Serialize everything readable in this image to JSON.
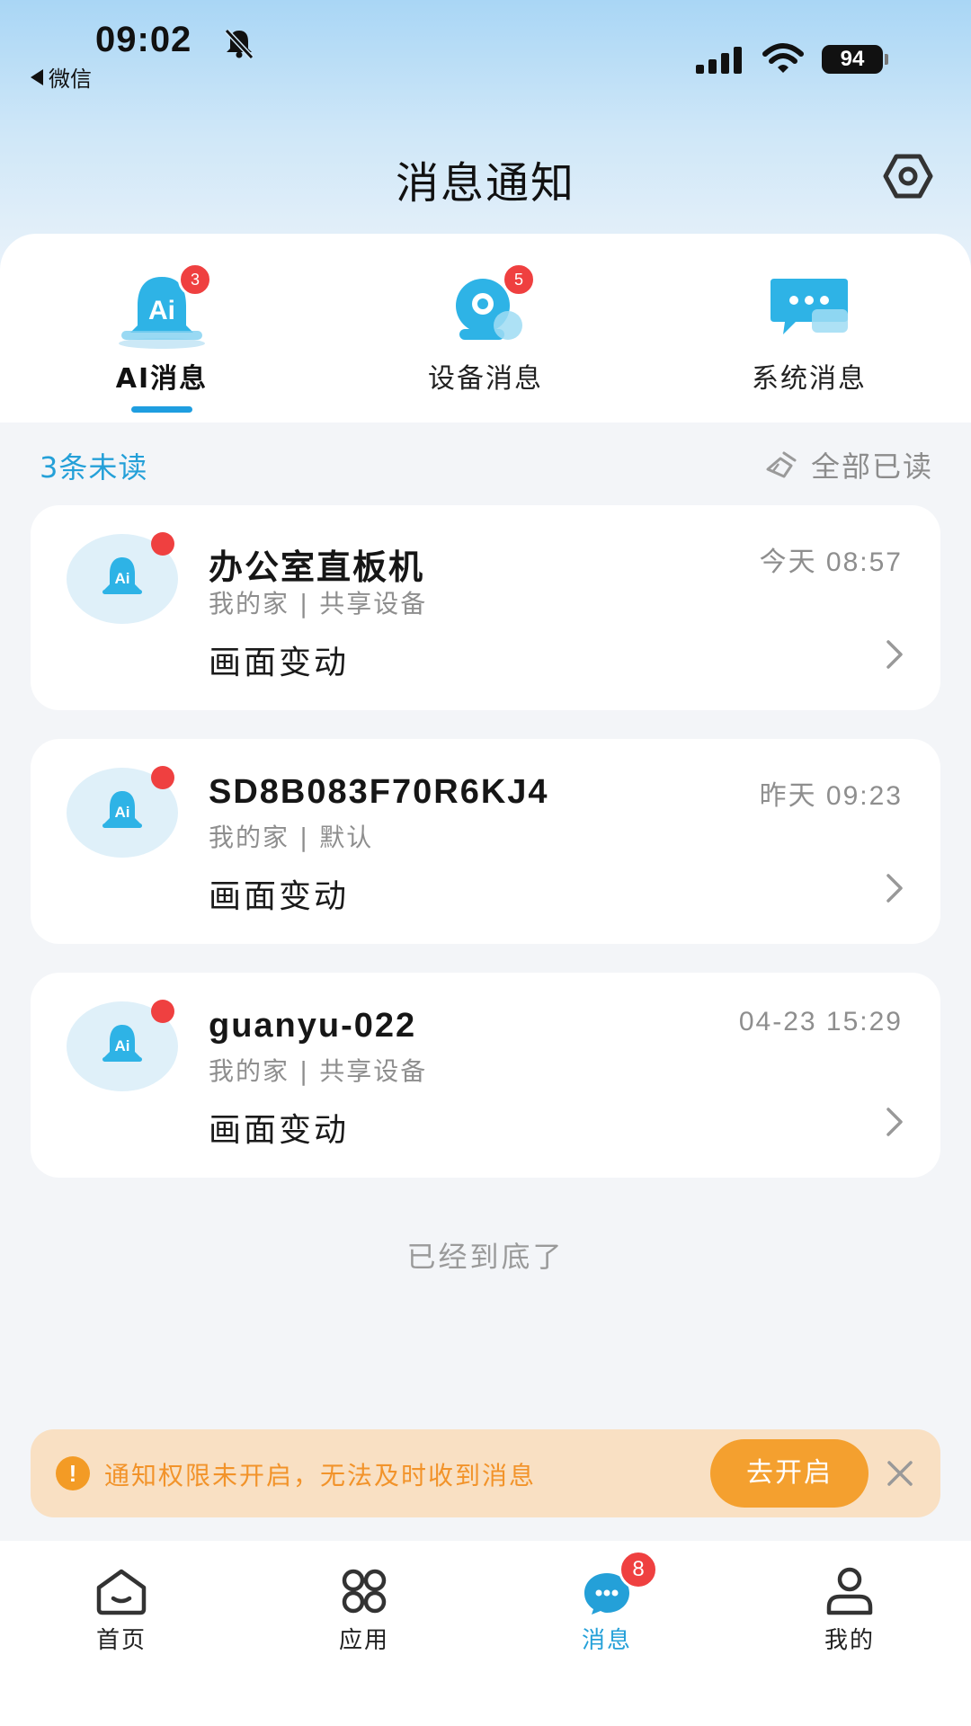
{
  "status_bar": {
    "time": "09:02",
    "back_app": "微信",
    "battery": "94"
  },
  "header": {
    "title": "消息通知",
    "settings_icon": "hexagon-settings-icon"
  },
  "tabs": [
    {
      "label": "AI消息",
      "badge": "3",
      "active": true
    },
    {
      "label": "设备消息",
      "badge": "5",
      "active": false
    },
    {
      "label": "系统消息",
      "badge": "",
      "active": false
    }
  ],
  "unread": {
    "count_text": "3条未读",
    "mark_all_label": "全部已读"
  },
  "messages": [
    {
      "title": "办公室直板机",
      "time": "今天 08:57",
      "sub": "我的家 | 共享设备",
      "event": "画面变动"
    },
    {
      "title": "SD8B083F70R6KJ4",
      "time": "昨天 09:23",
      "sub": "我的家 | 默认",
      "event": "画面变动"
    },
    {
      "title": "guanyu-022",
      "time": "04-23 15:29",
      "sub": "我的家 | 共享设备",
      "event": "画面变动"
    }
  ],
  "end_text": "已经到底了",
  "notice": {
    "text": "通知权限未开启，无法及时收到消息",
    "button_label": "去开启"
  },
  "bottom_nav": [
    {
      "label": "首页",
      "icon": "home-icon",
      "active": false
    },
    {
      "label": "应用",
      "icon": "apps-icon",
      "active": false
    },
    {
      "label": "消息",
      "icon": "message-icon",
      "active": true,
      "badge": "8"
    },
    {
      "label": "我的",
      "icon": "profile-icon",
      "active": false
    }
  ],
  "colors": {
    "accent": "#24a0d8",
    "badge": "#ef4040",
    "warning": "#f4a02f",
    "warning_bg": "#f9e0c3"
  }
}
